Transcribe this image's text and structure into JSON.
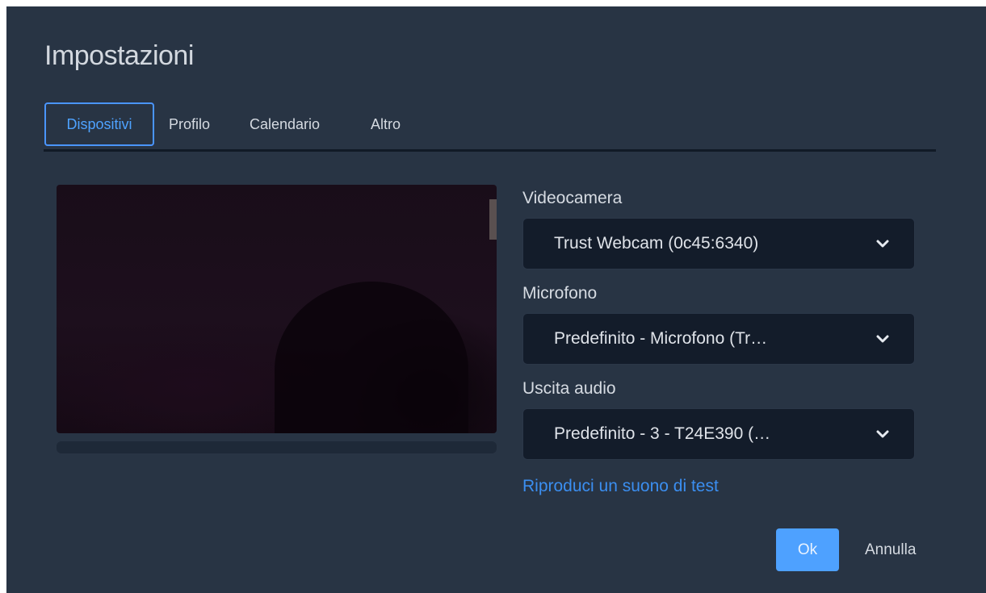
{
  "dialog": {
    "title": "Impostazioni"
  },
  "tabs": [
    {
      "label": "Dispositivi",
      "active": true
    },
    {
      "label": "Profilo",
      "active": false
    },
    {
      "label": "Calendario",
      "active": false
    },
    {
      "label": "Altro",
      "active": false
    }
  ],
  "devices": {
    "camera": {
      "label": "Videocamera",
      "value": "Trust Webcam (0c45:6340)"
    },
    "microphone": {
      "label": "Microfono",
      "value": "Predefinito - Microfono (Tr…"
    },
    "audio_output": {
      "label": "Uscita audio",
      "value": "Predefinito - 3 - T24E390 (…"
    },
    "test_sound_link": "Riproduci un suono di test"
  },
  "audio_level": 0,
  "buttons": {
    "ok": "Ok",
    "cancel": "Annulla"
  },
  "icons": {
    "select_arrow": "chevron-down-icon"
  },
  "colors": {
    "dialog_bg": "#283444",
    "accent": "#4ea1ff",
    "select_bg": "#131c2a"
  }
}
